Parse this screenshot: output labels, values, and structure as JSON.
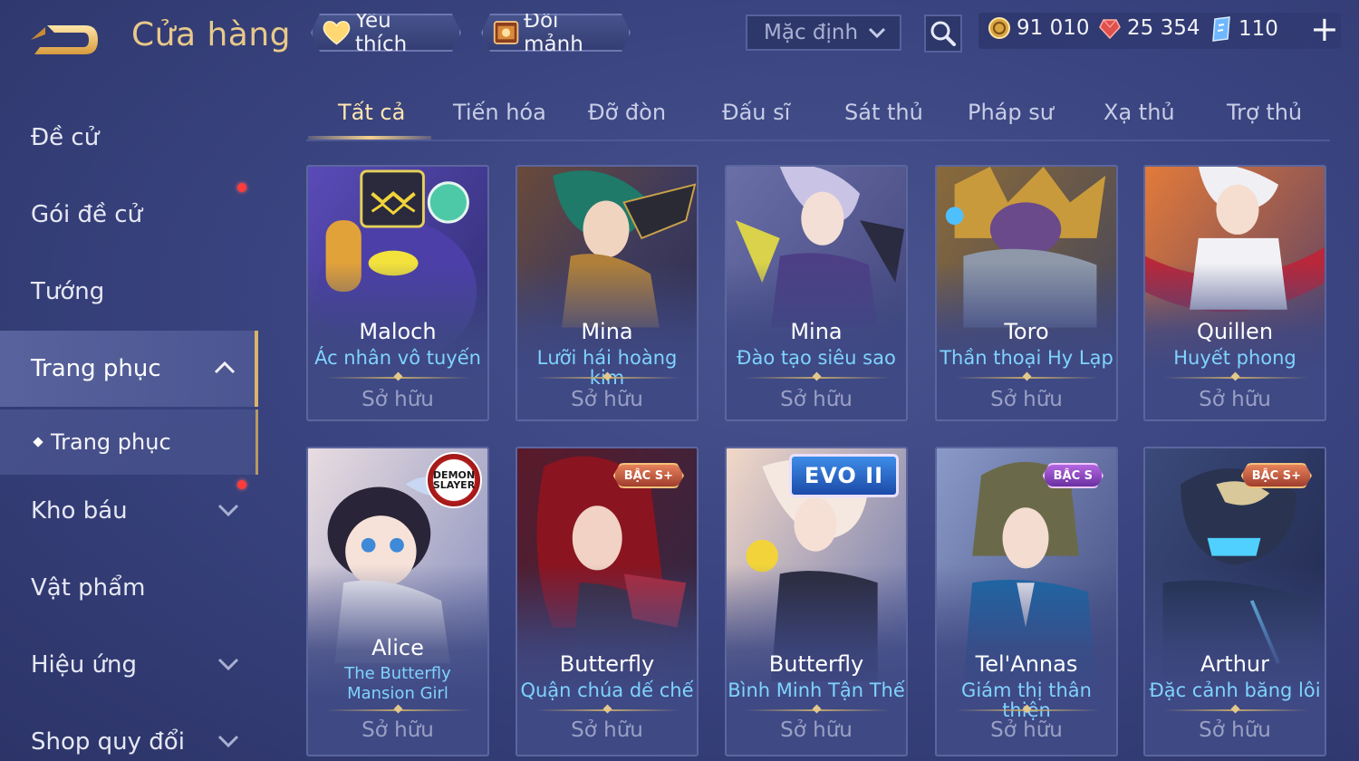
{
  "header": {
    "title": "Cửa hàng",
    "favorites_label": "Yêu thích",
    "shard_exchange_label": "Đổi mảnh",
    "sort_value": "Mặc định",
    "currencies": {
      "gold": "91 010",
      "ruby": "25 354",
      "voucher": "110"
    },
    "plus_label": "+"
  },
  "sidebar": {
    "items": [
      {
        "label": "Đề cử"
      },
      {
        "label": "Gói đề cử"
      },
      {
        "label": "Tướng"
      },
      {
        "label": "Trang phục"
      },
      {
        "label": "Kho báu"
      },
      {
        "label": "Vật phẩm"
      },
      {
        "label": "Hiệu ứng"
      },
      {
        "label": "Shop quy đổi"
      }
    ],
    "sub_item": "Trang phục"
  },
  "tabs": [
    "Tất cả",
    "Tiến hóa",
    "Đỡ đòn",
    "Đấu sĩ",
    "Sát thủ",
    "Pháp sư",
    "Xạ thủ",
    "Trợ thủ"
  ],
  "cards": [
    {
      "hero": "Maloch",
      "skin": "Ác nhân vô tuyến",
      "status": "Sở hữu",
      "badge": ""
    },
    {
      "hero": "Mina",
      "skin": "Lưỡi hái hoàng kim",
      "status": "Sở hữu",
      "badge": ""
    },
    {
      "hero": "Mina",
      "skin": "Đào tạo siêu sao",
      "status": "Sở hữu",
      "badge": ""
    },
    {
      "hero": "Toro",
      "skin": "Thần thoại Hy Lạp",
      "status": "Sở hữu",
      "badge": ""
    },
    {
      "hero": "Quillen",
      "skin": "Huyết phong",
      "status": "Sở hữu",
      "badge": ""
    },
    {
      "hero": "Alice",
      "skin": "The Butterfly Mansion Girl",
      "status": "Sở hữu",
      "badge": "DEMON SLAYER"
    },
    {
      "hero": "Butterfly",
      "skin": "Quận chúa dế chế",
      "status": "Sở hữu",
      "badge": "BẬC S+"
    },
    {
      "hero": "Butterfly",
      "skin": "Bình Minh Tận Thế",
      "status": "Sở hữu",
      "badge": "EVO II"
    },
    {
      "hero": "Tel'Annas",
      "skin": "Giám thị thân thiện",
      "status": "Sở hữu",
      "badge": "BẬC S"
    },
    {
      "hero": "Arthur",
      "skin": "Đặc cảnh băng lôi",
      "status": "Sở hữu",
      "badge": "BẬC S+"
    }
  ],
  "colors": {
    "background": "#3a4480",
    "title_gold": "#e8c98a",
    "skin_name_blue": "#7fd3ff",
    "owned_gray": "#9aa0c4",
    "active_tab": "#ffe7b0",
    "notification_red": "#ff3b3b"
  },
  "icons": {
    "back": "back-arrow-icon",
    "favorite": "heart-icon",
    "shard": "shard-chest-icon",
    "sort": "chevron-down-icon",
    "search": "search-icon",
    "gold": "gold-coin-icon",
    "ruby": "ruby-gem-icon",
    "voucher": "voucher-icon",
    "add": "plus-icon"
  }
}
